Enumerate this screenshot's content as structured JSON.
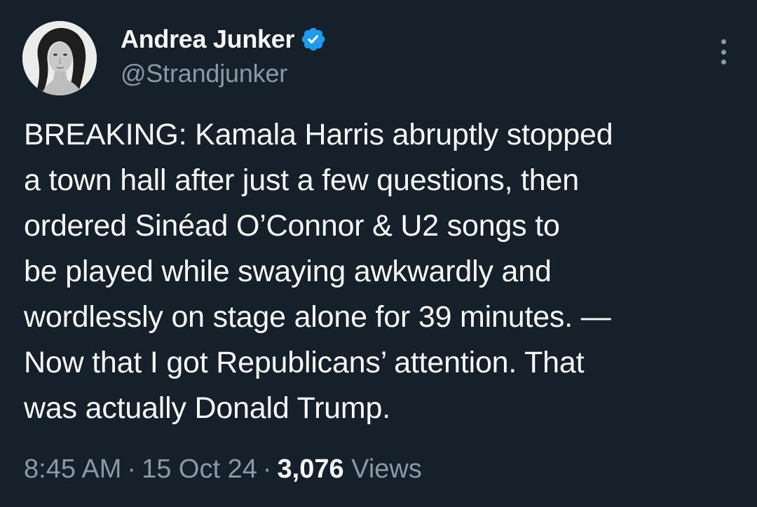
{
  "author": {
    "display_name": "Andrea Junker",
    "handle": "@Strandjunker",
    "verified": true,
    "verified_color": "#1d9bf0",
    "avatar_icon": "woman-portrait-avatar"
  },
  "menu": {
    "icon": "more-vertical-icon"
  },
  "tweet": {
    "lines": [
      "BREAKING: Kamala Harris abruptly stopped",
      "a town hall after just a few questions, then",
      "ordered Sinéad O’Connor & U2 songs to",
      "be played while swaying awkwardly and",
      "wordlessly on stage alone for 39 minutes. —",
      "Now that I got Republicans’ attention. That",
      "was actually Donald Trump."
    ]
  },
  "meta": {
    "time": "8:45 AM",
    "separator": "·",
    "date": "15 Oct 24",
    "views_count": "3,076",
    "views_label": "Views"
  },
  "colors": {
    "background": "#15202b",
    "primary_text": "#f7f9f9",
    "secondary_text": "#8b98a5",
    "accent": "#1d9bf0"
  }
}
